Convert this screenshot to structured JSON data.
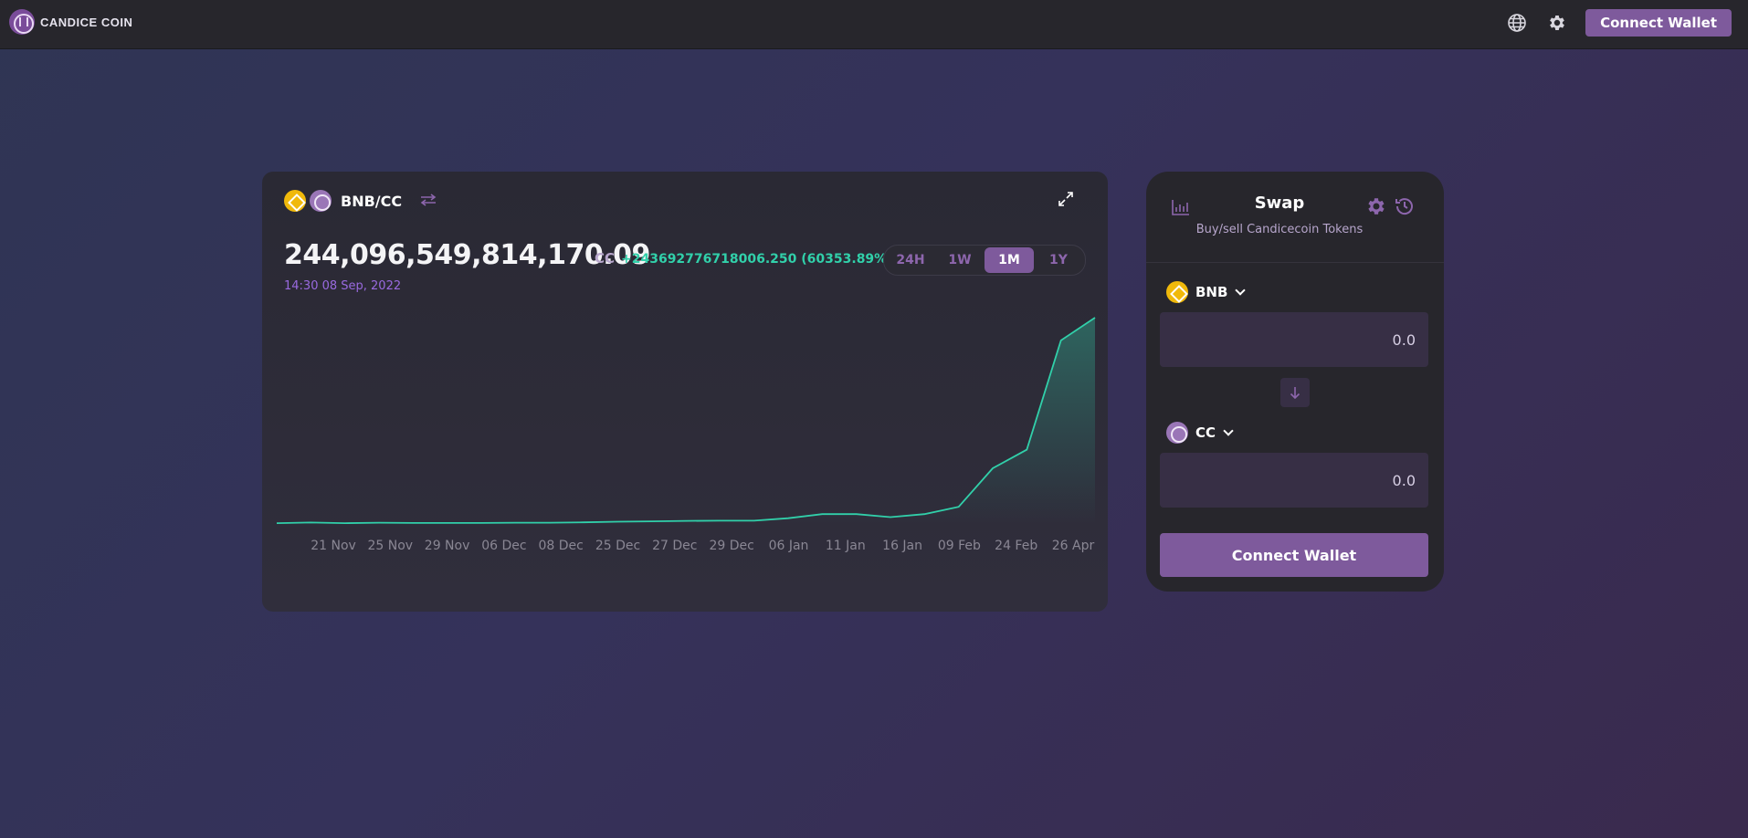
{
  "header": {
    "brand": "CANDICE COIN",
    "connect_label": "Connect Wallet",
    "icons": [
      "globe-icon",
      "gear-icon"
    ]
  },
  "chart_panel": {
    "pair": "BNB/CC",
    "price": "244,096,549,814,170.09",
    "unit": "CC",
    "change": "+243692776718006.250 (60353.89%)",
    "timestamp": "14:30 08 Sep, 2022",
    "ranges": [
      "24H",
      "1W",
      "1M",
      "1Y"
    ],
    "active_range": "1M",
    "colors": {
      "line": "#31d0aa",
      "accent": "#7e5a9c"
    }
  },
  "chart_data": {
    "type": "area",
    "title": "",
    "xlabel": "",
    "ylabel": "",
    "categories": [
      "21 Nov",
      "25 Nov",
      "29 Nov",
      "06 Dec",
      "08 Dec",
      "25 Dec",
      "27 Dec",
      "29 Dec",
      "06 Jan",
      "11 Jan",
      "16 Jan",
      "09 Feb",
      "24 Feb",
      "26 Apr"
    ],
    "series": [
      {
        "values": [
          0.4,
          0.7,
          0.4,
          0.6,
          0.5,
          0.5,
          0.5,
          0.6,
          0.6,
          0.8,
          1.1,
          1.3,
          1.5,
          1.6,
          1.6,
          2.8,
          4.8,
          4.8,
          3.3,
          4.8,
          8.3,
          27.0,
          36.0,
          89.0,
          100.0
        ]
      }
    ],
    "grid": false
  },
  "swap": {
    "title": "Swap",
    "subtitle": "Buy/sell Candicecoin Tokens",
    "from_token": "BNB",
    "from_amount": "0.0",
    "to_token": "CC",
    "to_amount": "0.0",
    "connect_label": "Connect Wallet"
  }
}
